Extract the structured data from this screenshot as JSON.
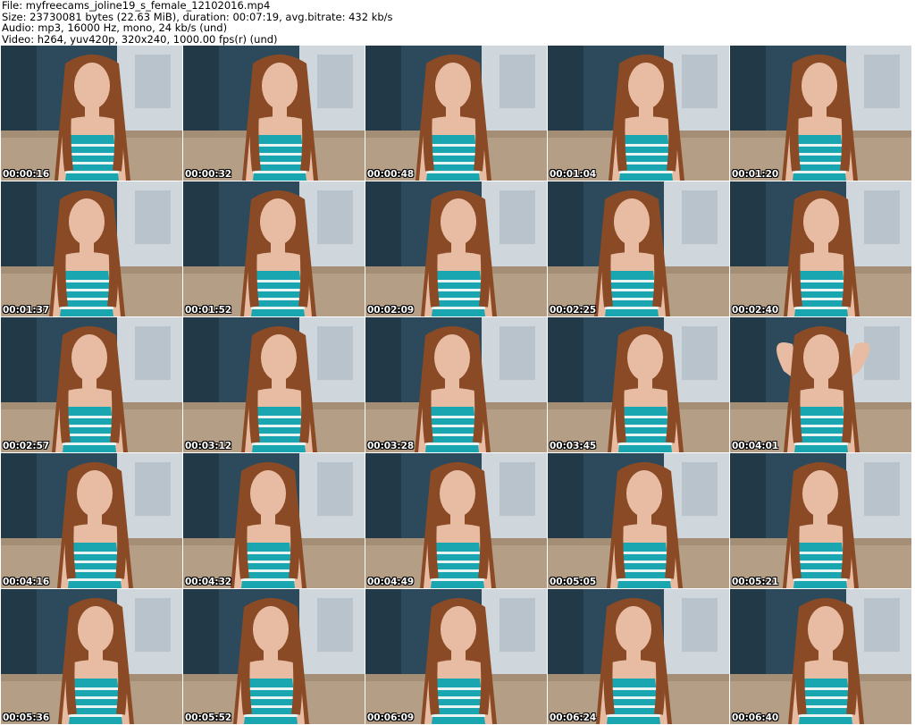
{
  "header": {
    "file": "File: myfreecams_joline19_s_female_12102016.mp4",
    "size": "Size: 23730081 bytes (22.63 MiB), duration: 00:07:19, avg.bitrate: 432 kb/s",
    "audio": "Audio: mp3, 16000 Hz, mono, 24 kb/s (und)",
    "video": "Video: h264, yuv420p, 320x240, 1000.00 fps(r) (und)"
  },
  "thumbnails": [
    {
      "timestamp": "00:00:16"
    },
    {
      "timestamp": "00:00:32"
    },
    {
      "timestamp": "00:00:48"
    },
    {
      "timestamp": "00:01:04"
    },
    {
      "timestamp": "00:01:20"
    },
    {
      "timestamp": "00:01:37"
    },
    {
      "timestamp": "00:01:52"
    },
    {
      "timestamp": "00:02:09"
    },
    {
      "timestamp": "00:02:25"
    },
    {
      "timestamp": "00:02:40"
    },
    {
      "timestamp": "00:02:57"
    },
    {
      "timestamp": "00:03:12"
    },
    {
      "timestamp": "00:03:28"
    },
    {
      "timestamp": "00:03:45"
    },
    {
      "timestamp": "00:04:01"
    },
    {
      "timestamp": "00:04:16"
    },
    {
      "timestamp": "00:04:32"
    },
    {
      "timestamp": "00:04:49"
    },
    {
      "timestamp": "00:05:05"
    },
    {
      "timestamp": "00:05:21"
    },
    {
      "timestamp": "00:05:36"
    },
    {
      "timestamp": "00:05:52"
    },
    {
      "timestamp": "00:06:09"
    },
    {
      "timestamp": "00:06:24"
    },
    {
      "timestamp": "00:06:40"
    }
  ],
  "colors": {
    "background": "#ffffff",
    "wall": "#2c4a5c",
    "poster": "#cfd6dc",
    "couch": "#b59e86",
    "hair": "#8a4a25",
    "skin": "#e7bca3",
    "top": "#1aa6b0",
    "stripe": "#e8f4f4"
  }
}
